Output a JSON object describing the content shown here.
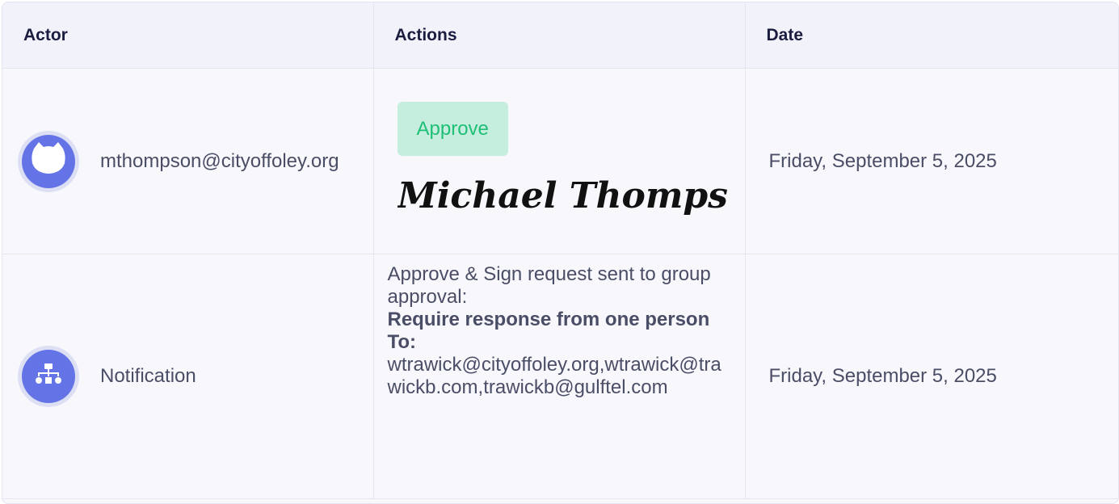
{
  "columns": {
    "actor": "Actor",
    "actions": "Actions",
    "date": "Date"
  },
  "rows": [
    {
      "actor": "mthompson@cityoffoley.org",
      "avatar_icon": "cat-face-icon",
      "action_badge": "Approve",
      "signature_text": "Michael Thompson",
      "date": "Friday, September 5, 2025"
    },
    {
      "actor": "Notification",
      "avatar_icon": "org-chart-icon",
      "action_intro": "Approve & Sign request sent to group approval:",
      "action_requirement": "Require response from one person",
      "action_to_label": "To:",
      "action_recipients": "wtrawick@cityoffoley.org,wtrawick@trawickb.com,trawickb@gulftel.com",
      "date": "Friday, September 5, 2025"
    }
  ],
  "colors": {
    "avatar": "#6474e6",
    "approve_bg": "#c6eedf",
    "approve_text": "#1fbf76",
    "header_bg": "#f1f2fa"
  }
}
